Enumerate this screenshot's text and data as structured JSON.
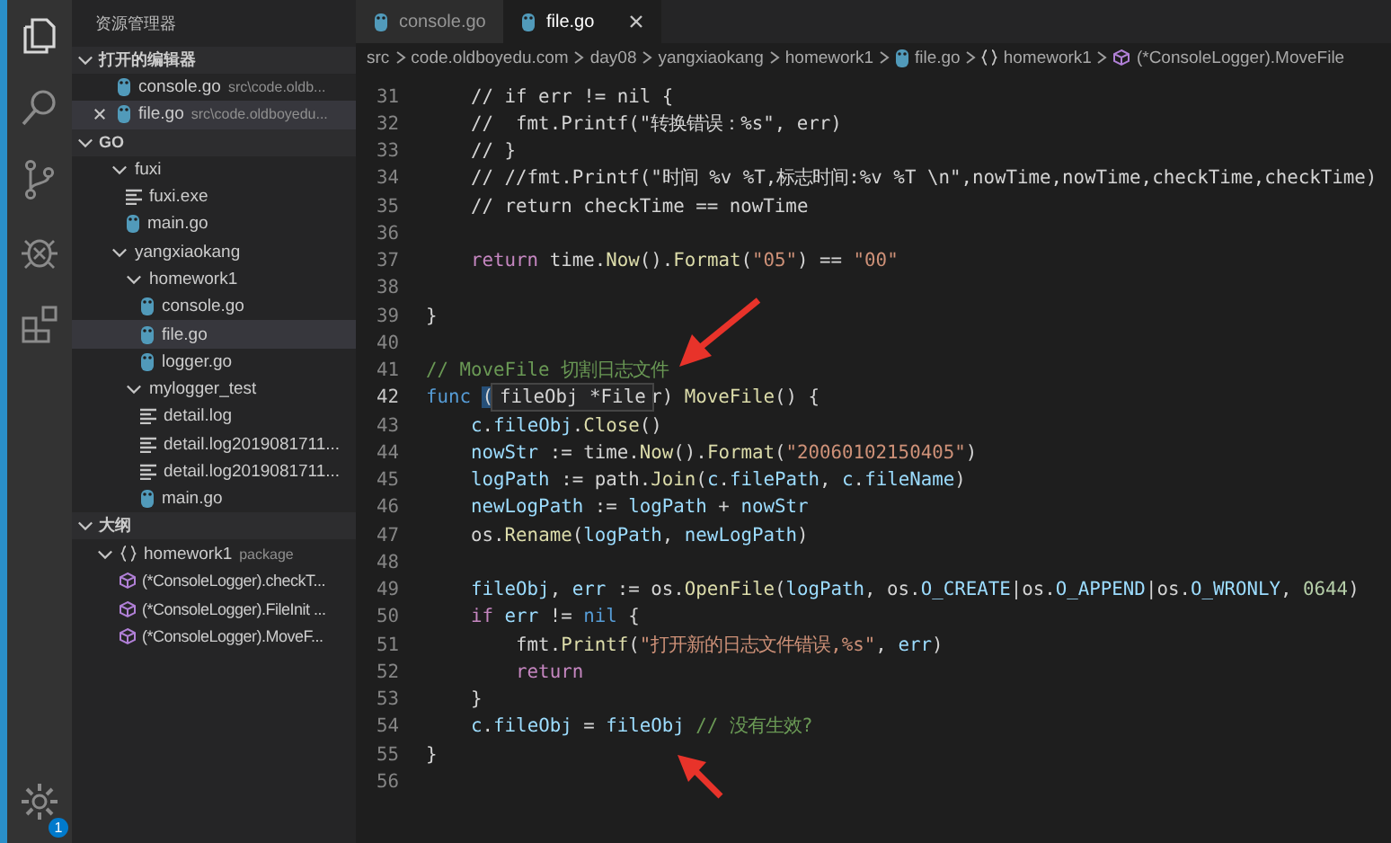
{
  "activity_bar": {
    "settings_badge": "1"
  },
  "sidebar": {
    "title": "资源管理器",
    "open_editors": {
      "title": "打开的编辑器",
      "expanded": true,
      "items": [
        {
          "name": "console.go",
          "path": "src\\code.oldb...",
          "selected": false
        },
        {
          "name": "file.go",
          "path": "src\\code.oldboyedu...",
          "selected": true
        }
      ]
    },
    "folder": {
      "title": "GO",
      "expanded": true,
      "items": [
        {
          "name": "fuxi",
          "kind": "folder",
          "expanded": true,
          "selected": false,
          "children": [
            {
              "name": "fuxi.exe",
              "kind": "file",
              "selected": false
            },
            {
              "name": "main.go",
              "kind": "go",
              "selected": false
            }
          ]
        },
        {
          "name": "yangxiaokang",
          "kind": "folder",
          "expanded": true,
          "selected": false,
          "children": [
            {
              "name": "homework1",
              "kind": "folder",
              "expanded": true,
              "selected": false,
              "children": [
                {
                  "name": "console.go",
                  "kind": "go",
                  "selected": false
                },
                {
                  "name": "file.go",
                  "kind": "go",
                  "selected": true
                },
                {
                  "name": "logger.go",
                  "kind": "go",
                  "selected": false
                }
              ]
            },
            {
              "name": "mylogger_test",
              "kind": "folder",
              "expanded": true,
              "selected": false,
              "children": [
                {
                  "name": "detail.log",
                  "kind": "file",
                  "selected": false
                },
                {
                  "name": "detail.log2019081711...",
                  "kind": "file",
                  "selected": false
                },
                {
                  "name": "detail.log2019081711...",
                  "kind": "file",
                  "selected": false
                },
                {
                  "name": "main.go",
                  "kind": "go",
                  "selected": false
                }
              ]
            }
          ]
        }
      ]
    },
    "outline": {
      "title": "大纲",
      "expanded": true,
      "items": [
        {
          "name": "homework1",
          "detail": "package",
          "kind": "package",
          "expanded": true,
          "children": [
            {
              "name": "(*ConsoleLogger).checkT...",
              "kind": "method"
            },
            {
              "name": "(*ConsoleLogger).FileInit ...",
              "kind": "method"
            },
            {
              "name": "(*ConsoleLogger).MoveF...",
              "kind": "method"
            }
          ]
        }
      ]
    }
  },
  "tabs": [
    {
      "label": "console.go",
      "selected": false
    },
    {
      "label": "file.go",
      "selected": true
    }
  ],
  "breadcrumbs": [
    {
      "text": "src",
      "kind": "text"
    },
    {
      "text": "code.oldboyedu.com",
      "kind": "text"
    },
    {
      "text": "day08",
      "kind": "text"
    },
    {
      "text": "yangxiaokang",
      "kind": "text"
    },
    {
      "text": "homework1",
      "kind": "text"
    },
    {
      "text": "file.go",
      "kind": "gofile"
    },
    {
      "text": "homework1",
      "kind": "namespace"
    },
    {
      "text": "(*ConsoleLogger).MoveFile",
      "kind": "method"
    }
  ],
  "editor": {
    "lines": [
      {
        "number": "31",
        "current": false,
        "tokens": [
          {
            "text": "    // if err != nil {",
            "kind": "plain"
          }
        ]
      },
      {
        "number": "32",
        "current": false,
        "tokens": [
          {
            "text": "    //  fmt.Printf(\"转换错误：%s\", err)",
            "kind": "plain"
          }
        ]
      },
      {
        "number": "33",
        "current": false,
        "tokens": [
          {
            "text": "    // }",
            "kind": "plain"
          }
        ]
      },
      {
        "number": "34",
        "current": false,
        "tokens": [
          {
            "text": "    // //fmt.Printf(\"时间 %v %T,标志时间:%v %T \\n\",nowTime,nowTime,checkTime,checkTime)",
            "kind": "plain"
          }
        ]
      },
      {
        "number": "35",
        "current": false,
        "tokens": [
          {
            "text": "    // return checkTime == nowTime",
            "kind": "plain"
          }
        ]
      },
      {
        "number": "36",
        "current": false
      },
      {
        "number": "37",
        "current": false,
        "tokens": [
          {
            "text": "    return",
            "kind": "control"
          },
          {
            "text": " time.",
            "kind": "plain"
          },
          {
            "text": "Now",
            "kind": "function"
          },
          {
            "text": "().",
            "kind": "plain"
          },
          {
            "text": "Format",
            "kind": "function"
          },
          {
            "text": "(",
            "kind": "plain"
          },
          {
            "text": "\"05\"",
            "kind": "string"
          },
          {
            "text": ") == ",
            "kind": "plain"
          },
          {
            "text": "\"00\"",
            "kind": "string"
          }
        ]
      },
      {
        "number": "38",
        "current": false
      },
      {
        "number": "39",
        "current": false,
        "tokens": [
          {
            "text": "}",
            "kind": "plain"
          }
        ]
      },
      {
        "number": "40",
        "current": false
      },
      {
        "number": "41",
        "current": false,
        "tokens": [
          {
            "text": "// MoveFile 切割日志文件",
            "kind": "comment"
          }
        ]
      },
      {
        "number": "42",
        "current": true,
        "hover": "fileObj *File",
        "tokens": [
          {
            "text": "func ",
            "kind": "keyword"
          },
          {
            "text": "(",
            "kind": "selection"
          },
          {
            "text": "              r) ",
            "kind": "plain"
          },
          {
            "text": "MoveFile",
            "kind": "function"
          },
          {
            "text": "() {",
            "kind": "plain"
          }
        ]
      },
      {
        "number": "43",
        "current": false,
        "tokens": [
          {
            "text": "    c",
            "kind": "variable"
          },
          {
            "text": ".",
            "kind": "plain"
          },
          {
            "text": "fileObj",
            "kind": "variable"
          },
          {
            "text": ".",
            "kind": "plain"
          },
          {
            "text": "Close",
            "kind": "function"
          },
          {
            "text": "()",
            "kind": "plain"
          }
        ]
      },
      {
        "number": "44",
        "current": false,
        "tokens": [
          {
            "text": "    nowStr",
            "kind": "variable"
          },
          {
            "text": " := time.",
            "kind": "plain"
          },
          {
            "text": "Now",
            "kind": "function"
          },
          {
            "text": "().",
            "kind": "plain"
          },
          {
            "text": "Format",
            "kind": "function"
          },
          {
            "text": "(",
            "kind": "plain"
          },
          {
            "text": "\"20060102150405\"",
            "kind": "string"
          },
          {
            "text": ")",
            "kind": "plain"
          }
        ]
      },
      {
        "number": "45",
        "current": false,
        "tokens": [
          {
            "text": "    logPath",
            "kind": "variable"
          },
          {
            "text": " := path.",
            "kind": "plain"
          },
          {
            "text": "Join",
            "kind": "function"
          },
          {
            "text": "(",
            "kind": "plain"
          },
          {
            "text": "c",
            "kind": "variable"
          },
          {
            "text": ".",
            "kind": "plain"
          },
          {
            "text": "filePath",
            "kind": "variable"
          },
          {
            "text": ", ",
            "kind": "plain"
          },
          {
            "text": "c",
            "kind": "variable"
          },
          {
            "text": ".",
            "kind": "plain"
          },
          {
            "text": "fileName",
            "kind": "variable"
          },
          {
            "text": ")",
            "kind": "plain"
          }
        ]
      },
      {
        "number": "46",
        "current": false,
        "tokens": [
          {
            "text": "    newLogPath",
            "kind": "variable"
          },
          {
            "text": " := ",
            "kind": "plain"
          },
          {
            "text": "logPath",
            "kind": "variable"
          },
          {
            "text": " + ",
            "kind": "plain"
          },
          {
            "text": "nowStr",
            "kind": "variable"
          }
        ]
      },
      {
        "number": "47",
        "current": false,
        "tokens": [
          {
            "text": "    os.",
            "kind": "plain"
          },
          {
            "text": "Rename",
            "kind": "function"
          },
          {
            "text": "(",
            "kind": "plain"
          },
          {
            "text": "logPath",
            "kind": "variable"
          },
          {
            "text": ", ",
            "kind": "plain"
          },
          {
            "text": "newLogPath",
            "kind": "variable"
          },
          {
            "text": ")",
            "kind": "plain"
          }
        ]
      },
      {
        "number": "48",
        "current": false
      },
      {
        "number": "49",
        "current": false,
        "tokens": [
          {
            "text": "    fileObj",
            "kind": "variable"
          },
          {
            "text": ", ",
            "kind": "plain"
          },
          {
            "text": "err",
            "kind": "variable"
          },
          {
            "text": " := os.",
            "kind": "plain"
          },
          {
            "text": "OpenFile",
            "kind": "function"
          },
          {
            "text": "(",
            "kind": "plain"
          },
          {
            "text": "logPath",
            "kind": "variable"
          },
          {
            "text": ", os.",
            "kind": "plain"
          },
          {
            "text": "O_CREATE",
            "kind": "variable"
          },
          {
            "text": "|os.",
            "kind": "plain"
          },
          {
            "text": "O_APPEND",
            "kind": "variable"
          },
          {
            "text": "|os.",
            "kind": "plain"
          },
          {
            "text": "O_WRONLY",
            "kind": "variable"
          },
          {
            "text": ", ",
            "kind": "plain"
          },
          {
            "text": "0644",
            "kind": "number"
          },
          {
            "text": ")",
            "kind": "plain"
          }
        ]
      },
      {
        "number": "50",
        "current": false,
        "tokens": [
          {
            "text": "    if",
            "kind": "control"
          },
          {
            "text": " err",
            "kind": "variable"
          },
          {
            "text": " != ",
            "kind": "plain"
          },
          {
            "text": "nil",
            "kind": "keyword"
          },
          {
            "text": " {",
            "kind": "plain"
          }
        ]
      },
      {
        "number": "51",
        "current": false,
        "tokens": [
          {
            "text": "        fmt.",
            "kind": "plain"
          },
          {
            "text": "Printf",
            "kind": "function"
          },
          {
            "text": "(",
            "kind": "plain"
          },
          {
            "text": "\"打开新的日志文件错误,%s\"",
            "kind": "string"
          },
          {
            "text": ", ",
            "kind": "plain"
          },
          {
            "text": "err",
            "kind": "variable"
          },
          {
            "text": ")",
            "kind": "plain"
          }
        ]
      },
      {
        "number": "52",
        "current": false,
        "tokens": [
          {
            "text": "        return",
            "kind": "control"
          }
        ]
      },
      {
        "number": "53",
        "current": false,
        "tokens": [
          {
            "text": "    }",
            "kind": "plain"
          }
        ]
      },
      {
        "number": "54",
        "current": false,
        "tokens": [
          {
            "text": "    c",
            "kind": "variable"
          },
          {
            "text": ".",
            "kind": "plain"
          },
          {
            "text": "fileObj",
            "kind": "variable"
          },
          {
            "text": " = ",
            "kind": "plain"
          },
          {
            "text": "fileObj",
            "kind": "variable"
          },
          {
            "text": " // 没有生效?",
            "kind": "comment"
          }
        ]
      },
      {
        "number": "55",
        "current": false,
        "tokens": [
          {
            "text": "}",
            "kind": "plain"
          }
        ]
      },
      {
        "number": "56",
        "current": false
      }
    ]
  }
}
